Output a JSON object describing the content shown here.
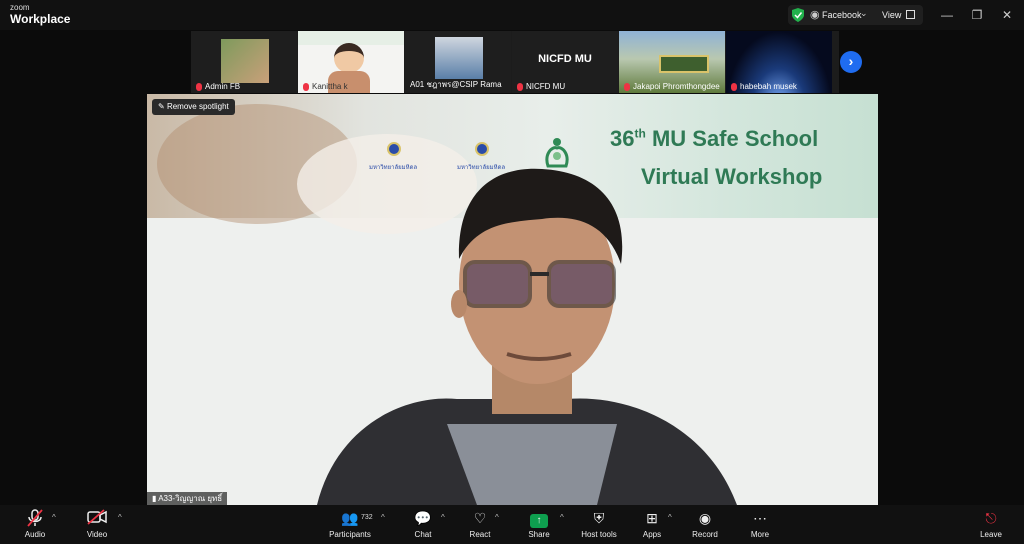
{
  "titlebar": {
    "brand_small": "zoom",
    "brand_large": "Workplace",
    "stream_label": "Facebook",
    "view_label": "View",
    "min": "—",
    "restore": "❐",
    "close": "✕"
  },
  "gallery": [
    {
      "name": "Admin FB"
    },
    {
      "name": "Kanittha k"
    },
    {
      "name": "A01 ชฎาพร@CSIP Rama",
      "mic_on": true
    },
    {
      "name": "NICFD MU",
      "title": "NICFD MU"
    },
    {
      "name": "Jakapoi Phromthongdee"
    },
    {
      "name": "habebah musek"
    }
  ],
  "main": {
    "remove_spotlight": "Remove spotlight",
    "speaker_name": "A33-วิญญาณ ยุทธิ์",
    "headline_number": "36",
    "headline_suffix": "th",
    "headline_line1": "MU Safe School",
    "headline_line2": "Virtual Workshop",
    "logo1_text": "มหาวิทยาลัยมหิดล",
    "logo2_text": "มหาวิทยาลัยมหิดล"
  },
  "toolbar": {
    "audio": "Audio",
    "video": "Video",
    "participants": "Participants",
    "participants_count": "732",
    "chat": "Chat",
    "react": "React",
    "share": "Share",
    "host_tools": "Host tools",
    "apps": "Apps",
    "record": "Record",
    "more": "More",
    "leave": "Leave"
  },
  "colors": {
    "accent": "#1f6cf0",
    "share_green": "#0e9f4f",
    "headline_green": "#2f7a55",
    "mute_red": "#e34"
  }
}
